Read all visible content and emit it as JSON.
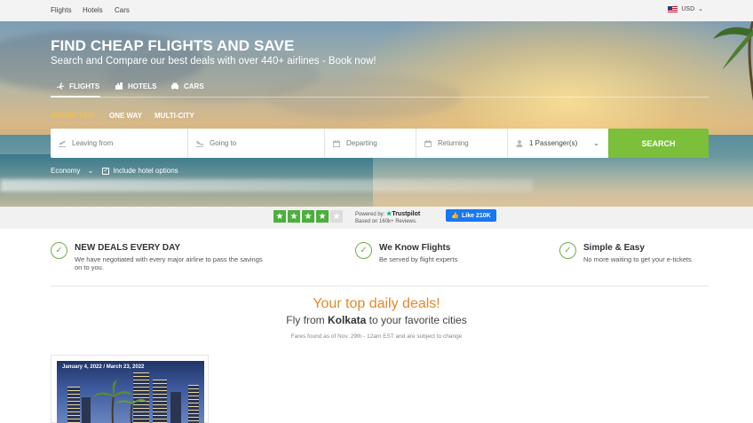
{
  "topnav": {
    "links": [
      "Flights",
      "Hotels",
      "Cars"
    ],
    "currency": "USD"
  },
  "hero": {
    "title": "FIND CHEAP FLIGHTS AND SAVE",
    "subtitle": "Search and Compare our best deals with over 440+ airlines - Book now!",
    "tabs": [
      "FLIGHTS",
      "HOTELS",
      "CARS"
    ],
    "trip_types": [
      "ROUND TRIP",
      "ONE WAY",
      "MULTI-CITY"
    ],
    "search": {
      "from_placeholder": "Leaving from",
      "to_placeholder": "Going to",
      "depart_placeholder": "Departing",
      "return_placeholder": "Returning",
      "passengers": "1 Passenger(s)",
      "button": "SEARCH"
    },
    "cabin": "Economy",
    "hotel_option": "Include hotel options"
  },
  "trust": {
    "rating_stars": 4,
    "max_stars": 5,
    "powered_by": "Powered by:",
    "brand": "Trustpilot",
    "reviews": "Based on 160k+ Reviews.",
    "fb_like": "Like 210K"
  },
  "features": [
    {
      "title": "NEW DEALS EVERY DAY",
      "text": "We have negotiated with every major airline to pass the savings on to you."
    },
    {
      "title": "We Know Flights",
      "text": "Be served by flight experts"
    },
    {
      "title": "Simple & Easy",
      "text": "No more waiting to get your e-tickets"
    }
  ],
  "deals": {
    "title": "Your top daily deals!",
    "sub_prefix": "Fly from",
    "city": "Kolkata",
    "sub_suffix": "to your favorite cities",
    "note": "Fares found as of Nov. 29th - 12am EST and are subject to change",
    "cards": [
      {
        "dates": "January 4, 2022 / March 23, 2022"
      }
    ]
  },
  "colors": {
    "accent_green": "#7bbf3a",
    "accent_orange": "#e08a2e",
    "trip_active": "#f2c14a"
  }
}
